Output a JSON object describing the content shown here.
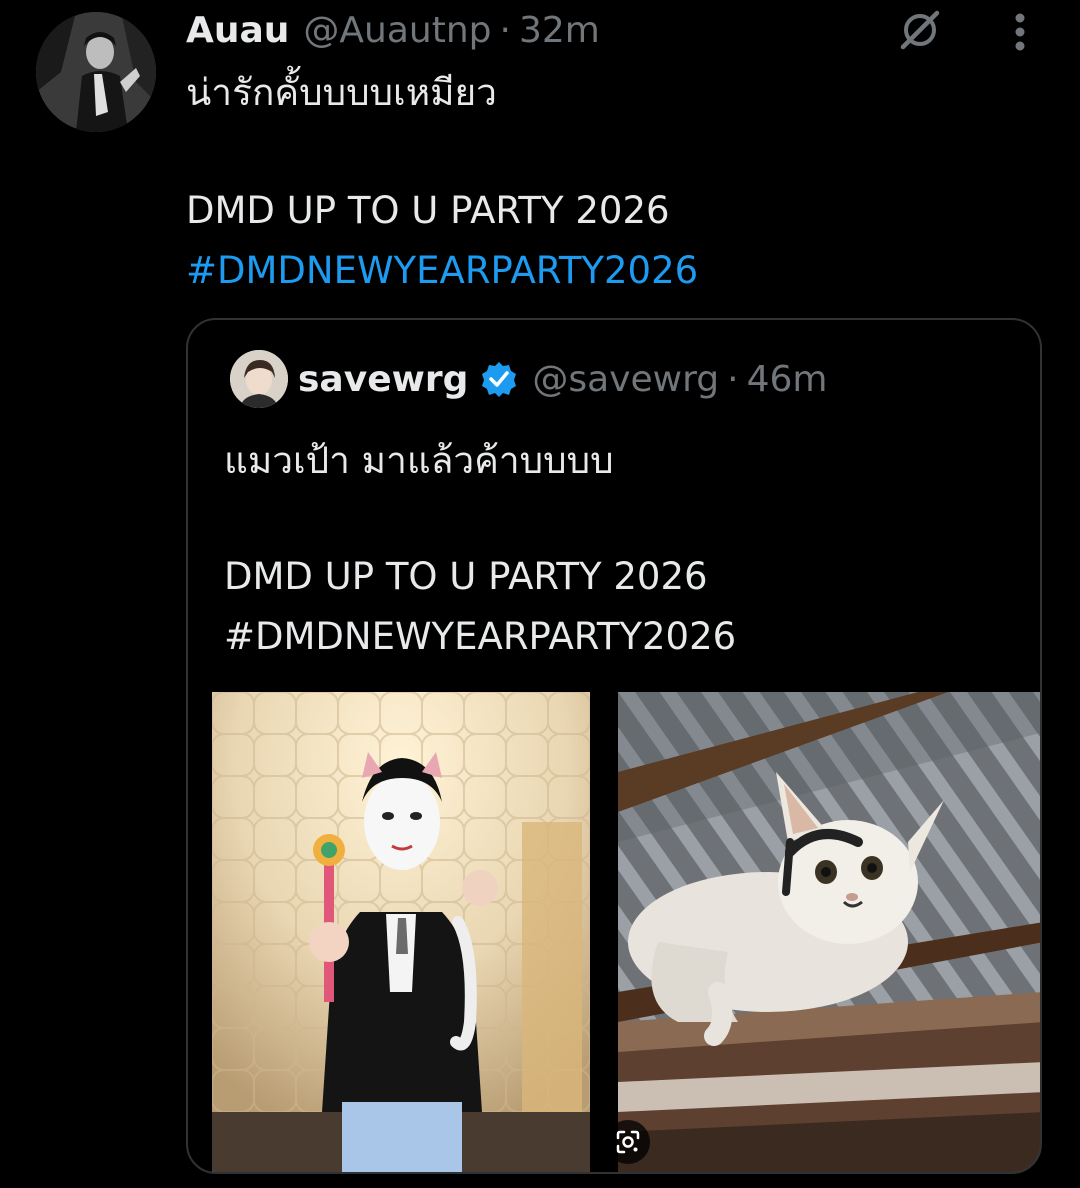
{
  "tweet": {
    "display_name": "Auau",
    "handle": "@Auautnp",
    "separator": "·",
    "time": "32m",
    "text_line1": "น่ารักคั้บบบบเหมียว",
    "text_line2": "DMD UP TO U PARTY 2026",
    "hashtag": "#DMDNEWYEARPARTY2026",
    "avatar_icon": "user-avatar-photo",
    "grok_icon": "grok-icon",
    "more_icon": "more-vertical-icon"
  },
  "quote": {
    "display_name": "savewrg",
    "handle": "@savewrg",
    "separator": "·",
    "time": "46m",
    "verified_icon": "verified-badge-icon",
    "text_line1": "แมวเป้า มาแล้วค้าบบบบ",
    "text_line2": "DMD UP TO U PARTY 2026",
    "text_line3": "#DMDNEWYEARPARTY2026",
    "media": [
      {
        "type": "photo",
        "subject": "person-in-cat-costume-photo"
      },
      {
        "type": "photo",
        "subject": "cat-on-roof-beam-photo"
      }
    ],
    "lens_icon": "google-lens-icon"
  },
  "colors": {
    "background": "#000000",
    "text": "#e7e9ea",
    "secondary": "#71767b",
    "link": "#1d9bf0",
    "border": "#2f3336",
    "verified": "#1d9bf0"
  }
}
